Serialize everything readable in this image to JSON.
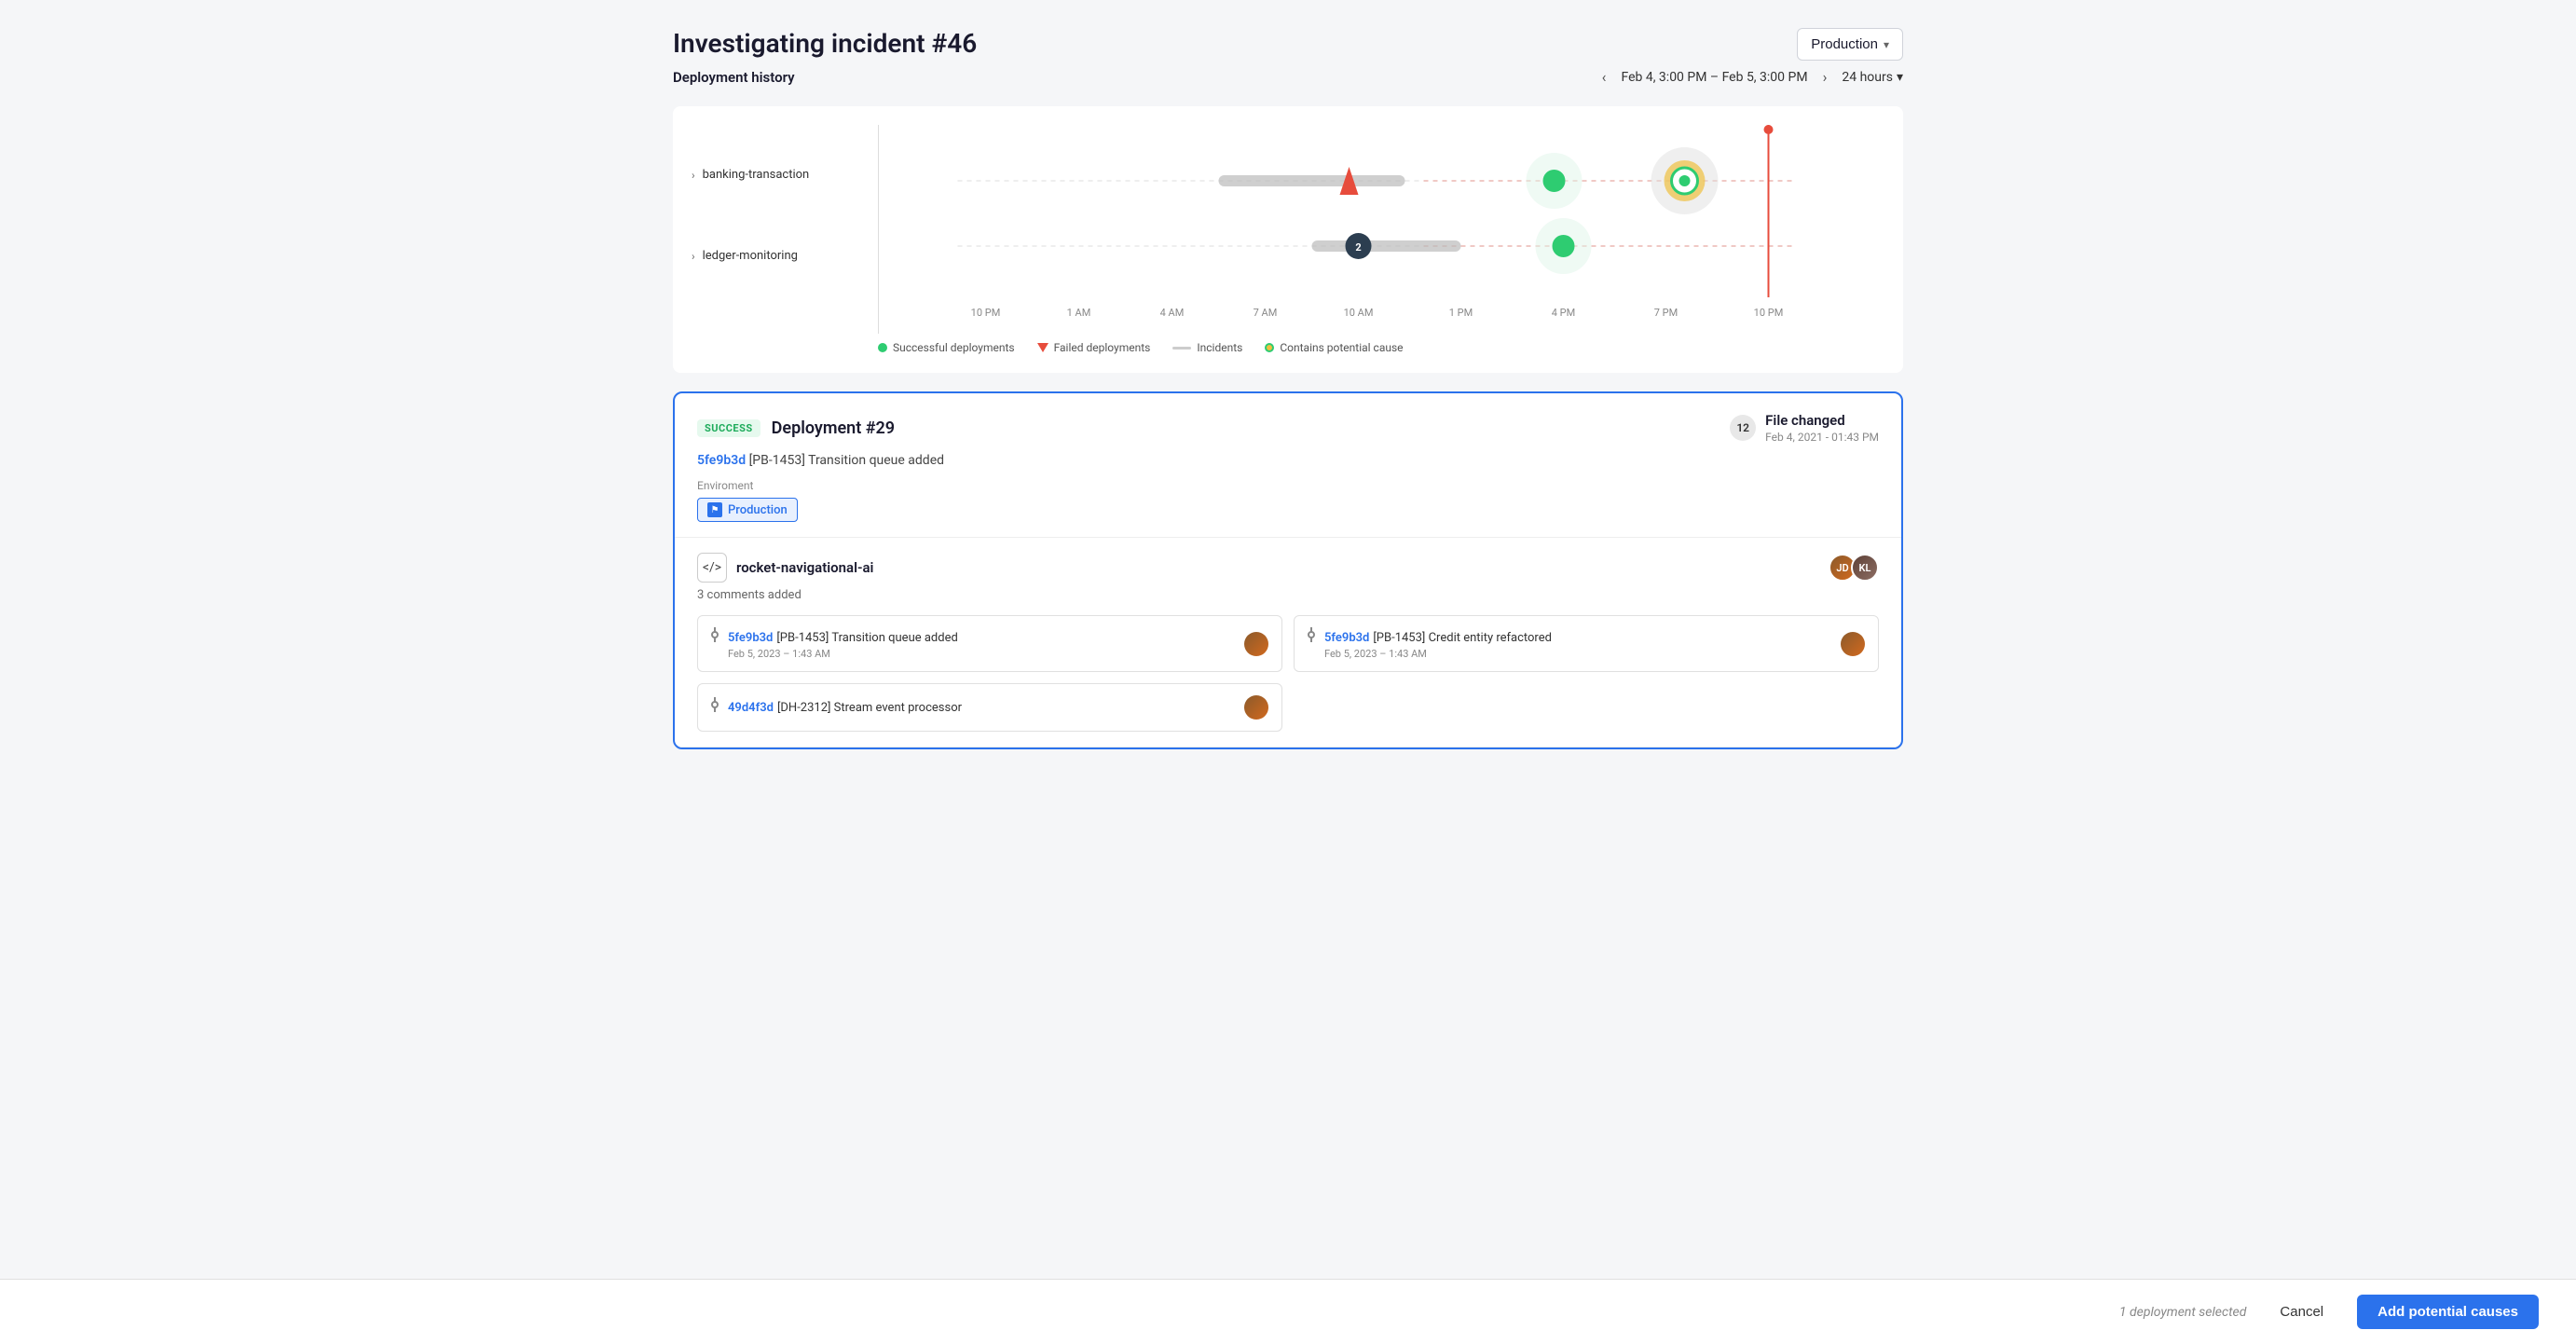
{
  "page": {
    "title": "Investigating incident #46",
    "env_dropdown": {
      "label": "Production",
      "chevron": "▾"
    },
    "deployment_history": {
      "label": "Deployment history",
      "time_range": "Feb 4, 3:00 PM – Feb 5, 3:00 PM",
      "hours_label": "24 hours"
    },
    "chart": {
      "services": [
        {
          "name": "banking-transaction",
          "arrow": "›"
        },
        {
          "name": "ledger-monitoring",
          "arrow": "›"
        }
      ],
      "x_labels": [
        "10 PM",
        "1 AM",
        "4 AM",
        "7 AM",
        "10 AM",
        "1 PM",
        "4 PM",
        "7 PM",
        "10 PM"
      ],
      "legend": [
        {
          "type": "green-dot",
          "label": "Successful deployments"
        },
        {
          "type": "red-triangle",
          "label": "Failed deployments"
        },
        {
          "type": "gray-line",
          "label": "Incidents"
        },
        {
          "type": "yellow-dot",
          "label": "Contains potential cause"
        }
      ]
    },
    "deployment_card": {
      "status_badge": "SUCCESS",
      "title": "Deployment #29",
      "file_count": "12",
      "file_changed_label": "File changed",
      "file_changed_date": "Feb 4, 2021 - 01:43 PM",
      "commit_hash": "5fe9b3d",
      "commit_message": "[PB-1453] Transition queue added",
      "env_label": "Enviroment",
      "env_tag": "Production",
      "service_icon": "</>",
      "service_name": "rocket-navigational-ai",
      "comments_count": "3 comments added",
      "commits": [
        {
          "hash": "5fe9b3d",
          "message": "[PB-1453] Transition queue added",
          "date": "Feb 5, 2023 – 1:43 AM"
        },
        {
          "hash": "5fe9b3d",
          "message": "[PB-1453] Credit entity refactored",
          "date": "Feb 5, 2023 – 1:43 AM"
        },
        {
          "hash": "49d4f3d",
          "message": "[DH-2312] Stream event processor",
          "date": ""
        }
      ]
    },
    "action_bar": {
      "selected_text": "1 deployment selected",
      "cancel_label": "Cancel",
      "add_causes_label": "Add potential causes"
    }
  }
}
